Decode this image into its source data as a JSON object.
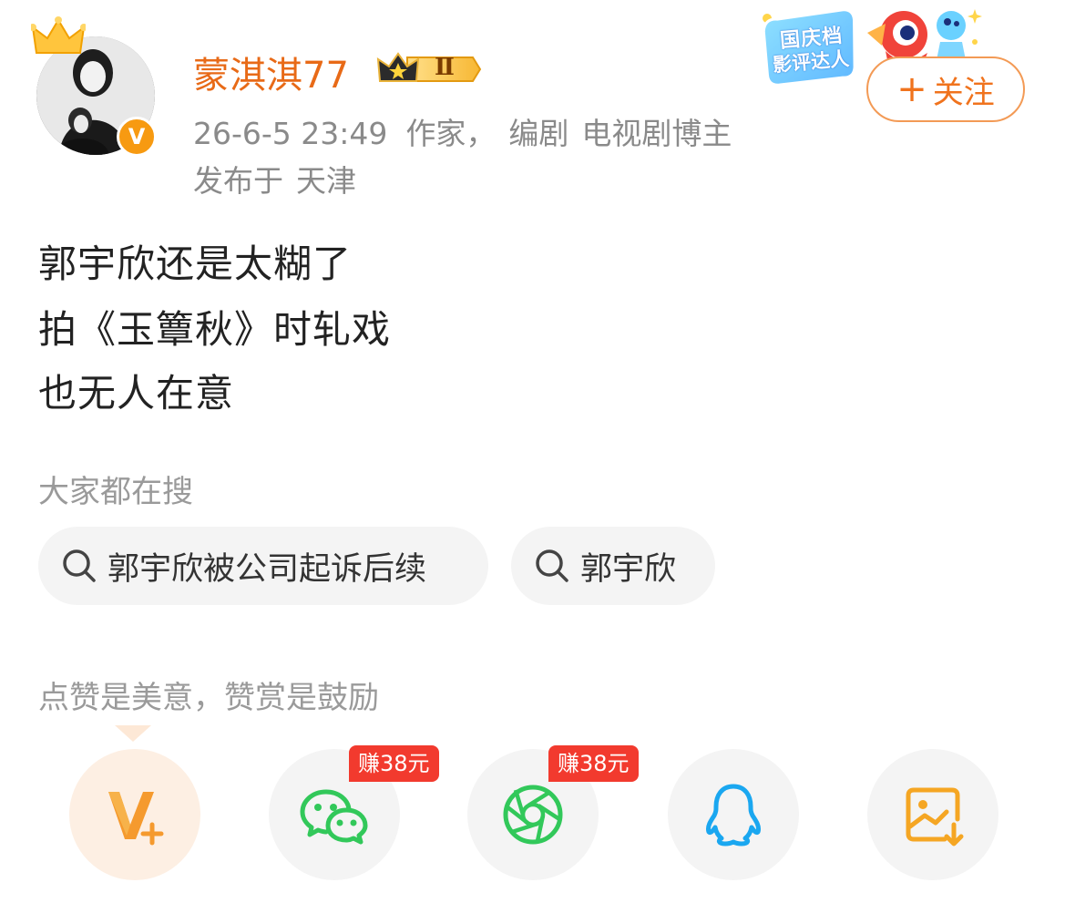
{
  "header": {
    "username": "蒙淇淇77",
    "level_badge": "Ⅱ",
    "timestamp": "26-6-5 23:49",
    "tag_1": "作家，",
    "tag_2": "编剧",
    "tag_3": "电视剧博主",
    "location_prefix": "发布于",
    "location": "天津",
    "event_badge_line1": "国庆档",
    "event_badge_line2": "影评达人",
    "verified_badge": "V",
    "follow_button": {
      "plus": "+",
      "label": "关注"
    }
  },
  "post": {
    "lines": [
      "郭宇欣还是太糊了",
      "拍《玉簟秋》时轧戏",
      "也无人在意"
    ]
  },
  "search_section": {
    "label": "大家都在搜",
    "chips": [
      "郭宇欣被公司起诉后续",
      "郭宇欣"
    ]
  },
  "reward_section": {
    "label": "点赞是美意，赞赏是鼓励"
  },
  "share": {
    "items": [
      {
        "icon": "v-plus-icon",
        "badge": ""
      },
      {
        "icon": "wechat-icon",
        "badge": "赚38元"
      },
      {
        "icon": "moments-icon",
        "badge": "赚38元"
      },
      {
        "icon": "qq-icon",
        "badge": ""
      },
      {
        "icon": "save-image-icon",
        "badge": ""
      }
    ]
  },
  "colors": {
    "accent": "#f0731d",
    "username": "#e86a17",
    "muted": "#8a8a8a",
    "chip_bg": "#f4f4f4",
    "earn_badge": "#f23a2e",
    "wechat": "#32c85a",
    "qq": "#1aa7f0",
    "save": "#f5a623"
  }
}
